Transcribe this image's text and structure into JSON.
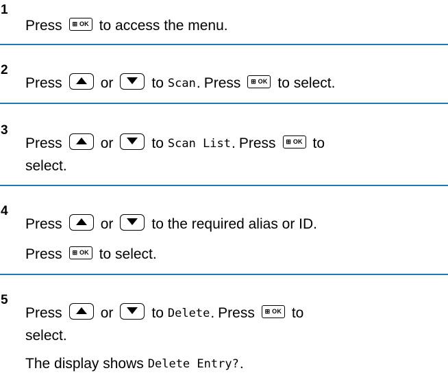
{
  "steps": [
    {
      "number": "1",
      "lines": [
        [
          "Press",
          "KEY_OK",
          "to access the menu."
        ]
      ]
    },
    {
      "number": "2",
      "lines": [
        [
          "Press",
          "KEY_UP",
          "or",
          "KEY_DOWN",
          "to",
          "MONO:Scan.",
          "Press",
          "KEY_OK",
          "to select."
        ]
      ]
    }
  ],
  "text": {
    "press": "Press",
    "or": "or",
    "to": "to",
    "to_select": "to select.",
    "to_access_menu": "to access the menu.",
    "select": "select.",
    "to_required_alias": "to the required alias or ID.",
    "display_shows": "The display shows",
    "ok_key_label": "⊞ OK",
    "mono_scan": "Scan",
    "mono_scan_list": "Scan List",
    "mono_delete": "Delete",
    "mono_delete_entry": "Delete Entry?",
    "period": "."
  },
  "step_numbers": [
    "1",
    "2",
    "3",
    "4",
    "5"
  ],
  "icons": {
    "ok": "menu-ok-key-icon",
    "up": "up-arrow-key-icon",
    "down": "down-arrow-key-icon"
  },
  "colors": {
    "separator": "#1f78b4"
  }
}
